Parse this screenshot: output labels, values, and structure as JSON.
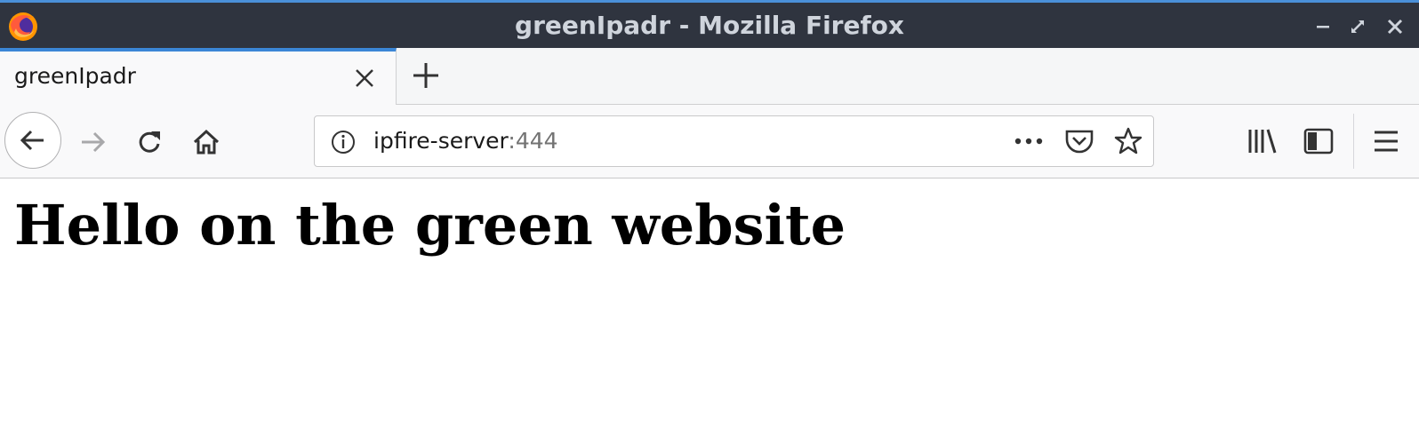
{
  "window": {
    "title": "greenIpadr - Mozilla Firefox",
    "controls": [
      "minimize-icon",
      "maximize-icon",
      "close-icon"
    ]
  },
  "tabs": [
    {
      "label": "greenIpadr",
      "active": true
    }
  ],
  "toolbar": {
    "icons": [
      "back-icon",
      "forward-icon",
      "reload-icon",
      "home-icon"
    ],
    "url": {
      "host": "ipfire-server",
      "port": ":444"
    },
    "url_icons": [
      "site-info-icon",
      "page-actions-icon",
      "pocket-icon",
      "bookmark-star-icon"
    ],
    "right_icons": [
      "library-icon",
      "sidebar-icon",
      "menu-icon"
    ]
  },
  "page": {
    "heading": "Hello on the green website"
  },
  "colors": {
    "titlebar_bg": "#2f343f",
    "tab_accent": "#3b86d6",
    "toolbar_bg": "#f9f9fa"
  }
}
